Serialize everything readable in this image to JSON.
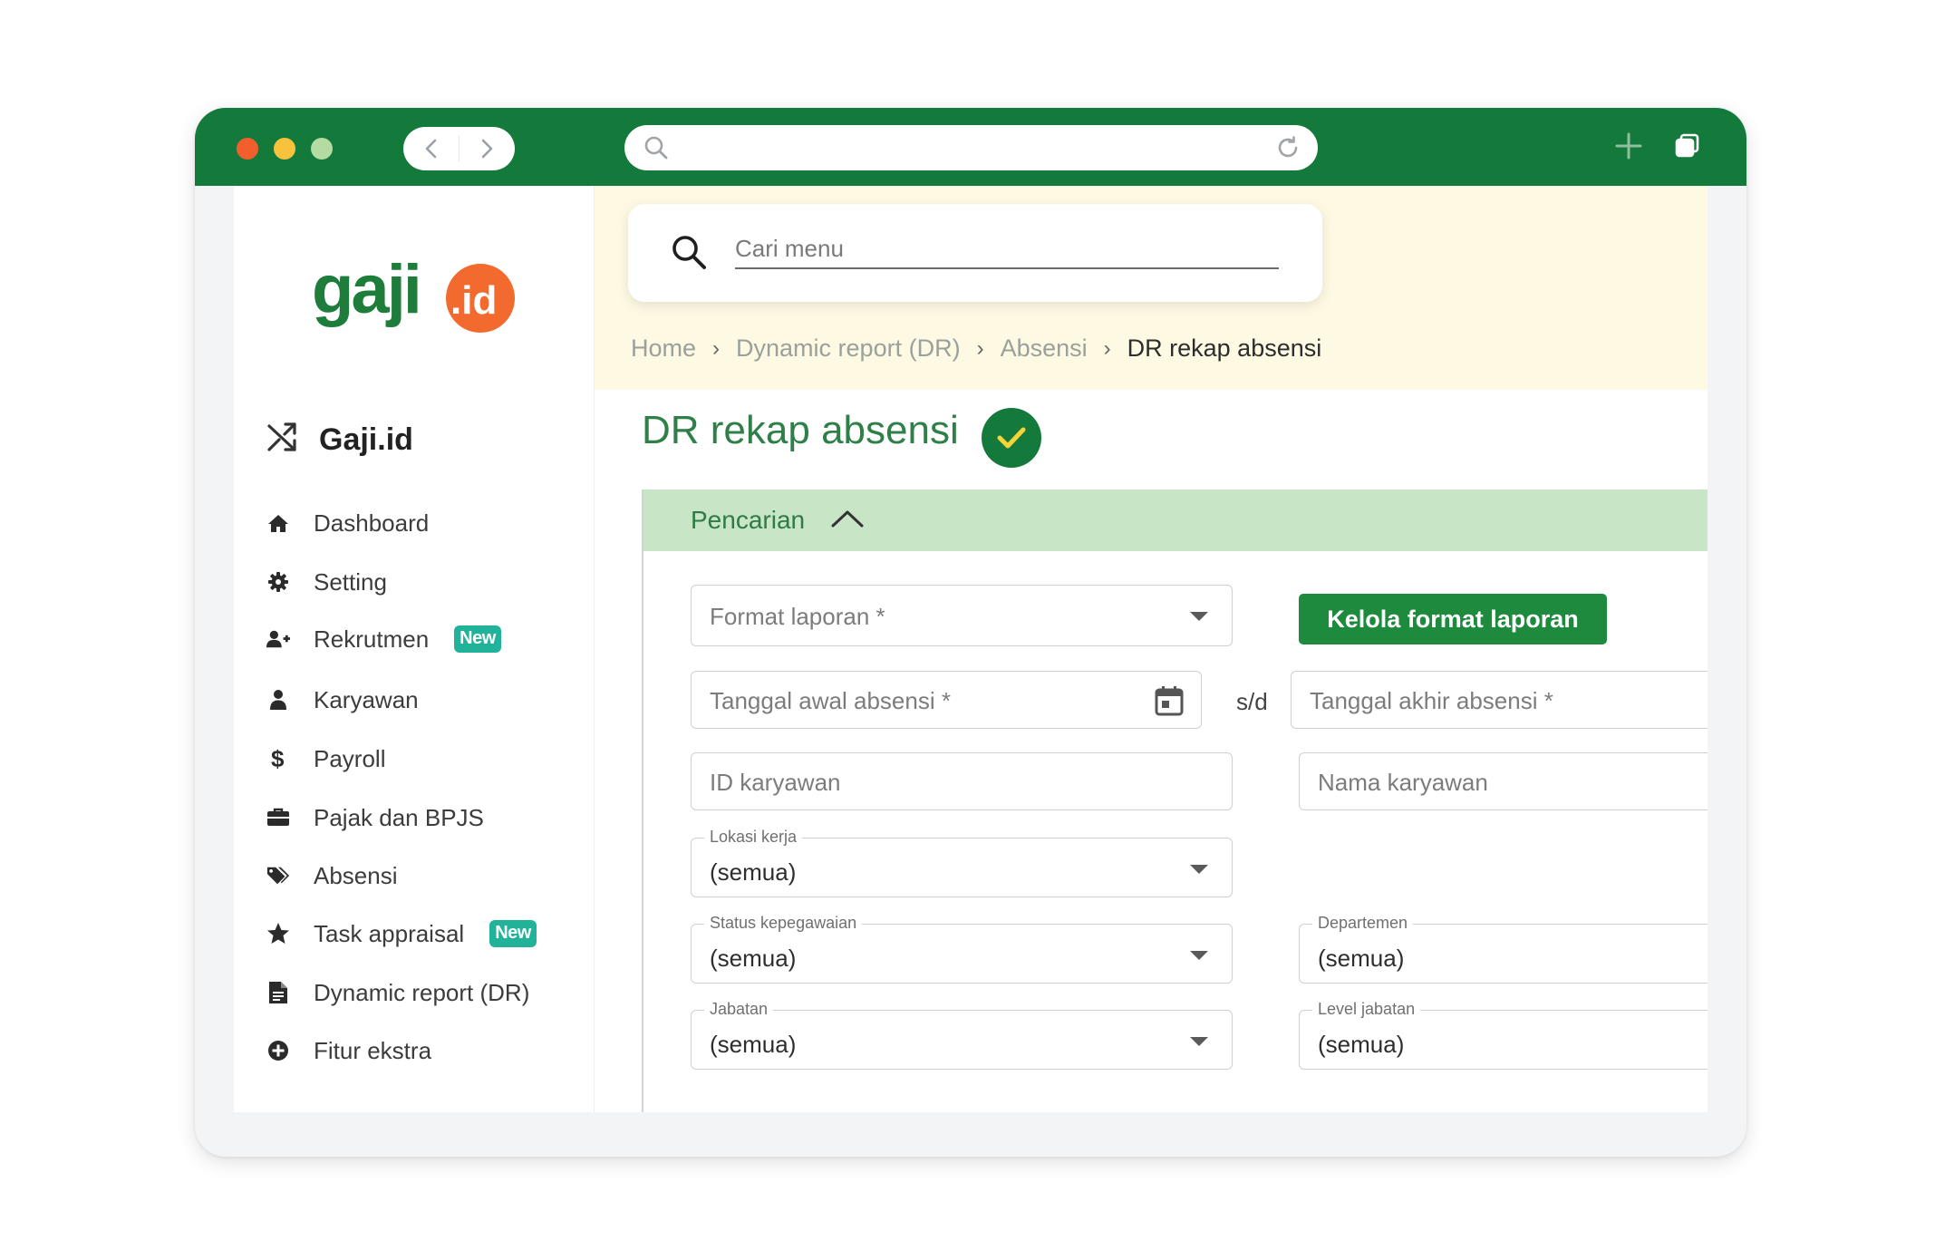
{
  "colors": {
    "titlebar": "#137a3c",
    "accent_green": "#1e8a3e",
    "title_green": "#2f8048",
    "panel_header_bg": "#c8e6c6",
    "badge": "#20b39a",
    "topband": "#fdf9e3",
    "logo_green": "#1e7d3a",
    "logo_orange": "#f26a2e"
  },
  "browser": {
    "icons": [
      "back-icon",
      "forward-icon",
      "search-icon",
      "reload-icon",
      "plus-icon",
      "copy-icon"
    ]
  },
  "logo": {
    "text_main": "gaji",
    "text_suffix": ".id"
  },
  "brand": {
    "name": "Gaji.id",
    "icon": "shuffle-icon"
  },
  "sidebar": {
    "items": [
      {
        "label": "Dashboard",
        "icon": "home-icon",
        "badge": ""
      },
      {
        "label": "Setting",
        "icon": "gear-icon",
        "badge": ""
      },
      {
        "label": "Rekrutmen",
        "icon": "user-plus-icon",
        "badge": "New"
      },
      {
        "label": "Karyawan",
        "icon": "user-icon",
        "badge": ""
      },
      {
        "label": "Payroll",
        "icon": "dollar-icon",
        "badge": ""
      },
      {
        "label": "Pajak dan BPJS",
        "icon": "briefcase-icon",
        "badge": ""
      },
      {
        "label": "Absensi",
        "icon": "tags-icon",
        "badge": ""
      },
      {
        "label": "Task appraisal",
        "icon": "star-icon",
        "badge": "New"
      },
      {
        "label": "Dynamic report (DR)",
        "icon": "document-icon",
        "badge": ""
      },
      {
        "label": "Fitur ekstra",
        "icon": "plus-circle-icon",
        "badge": ""
      }
    ]
  },
  "search": {
    "placeholder": "Cari menu"
  },
  "breadcrumb": {
    "items": [
      "Home",
      "Dynamic report (DR)",
      "Absensi",
      "DR rekap absensi"
    ],
    "separator": "›"
  },
  "page": {
    "title": "DR rekap absensi"
  },
  "panel": {
    "title": "Pencarian"
  },
  "form": {
    "format_laporan": {
      "placeholder": "Format laporan *"
    },
    "kelola_button": "Kelola format laporan",
    "tanggal_awal": {
      "placeholder": "Tanggal awal absensi *"
    },
    "sd": "s/d",
    "tanggal_akhir": {
      "placeholder": "Tanggal akhir absensi *"
    },
    "id_karyawan": {
      "placeholder": "ID karyawan"
    },
    "nama_karyawan": {
      "placeholder": "Nama karyawan"
    },
    "lokasi_kerja": {
      "label": "Lokasi kerja",
      "value": "(semua)"
    },
    "status_kepegawaian": {
      "label": "Status kepegawaian",
      "value": "(semua)"
    },
    "departemen": {
      "label": "Departemen",
      "value": "(semua)"
    },
    "jabatan": {
      "label": "Jabatan",
      "value": "(semua)"
    },
    "level_jabatan": {
      "label": "Level jabatan",
      "value": "(semua)"
    }
  }
}
